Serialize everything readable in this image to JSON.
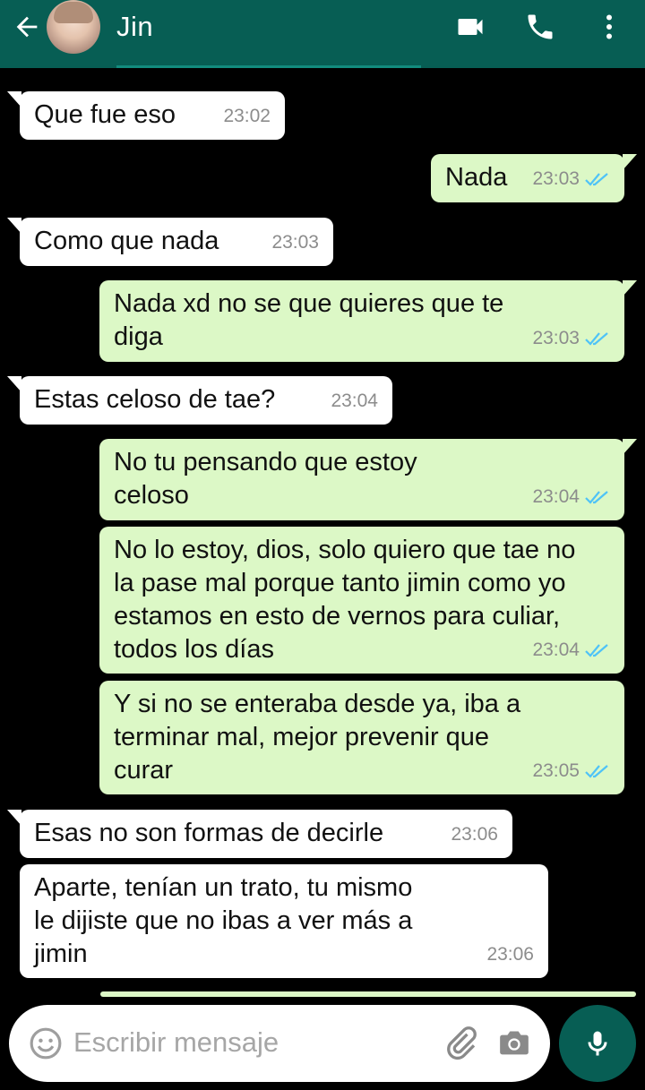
{
  "header": {
    "contact_name": "Jin",
    "icons": [
      "back-arrow-icon",
      "avatar",
      "video-call-icon",
      "phone-icon",
      "more-vert-icon"
    ],
    "colors": {
      "bar": "#075E54"
    }
  },
  "messages": [
    {
      "side": "in",
      "text": "Que fue eso",
      "time": "23:02"
    },
    {
      "side": "out",
      "text": "Nada",
      "time": "23:03",
      "status": "read"
    },
    {
      "side": "in",
      "text": "Como que nada",
      "time": "23:03"
    },
    {
      "side": "out",
      "text": "Nada xd no se que quieres que te\ndiga",
      "time": "23:03",
      "status": "read"
    },
    {
      "side": "in",
      "text": "Estas celoso de tae?",
      "time": "23:04"
    },
    {
      "side": "out",
      "text": "No tu pensando que estoy\nceloso",
      "time": "23:04",
      "status": "read"
    },
    {
      "side": "out",
      "text": "No lo estoy, dios, solo quiero que tae no\nla pase mal porque tanto jimin como yo\nestamos en esto de vernos para culiar,\ntodos los días",
      "time": "23:04",
      "status": "read"
    },
    {
      "side": "out",
      "text": "Y si no se enteraba desde ya, iba a\nterminar mal, mejor prevenir que\ncurar",
      "time": "23:05",
      "status": "read"
    },
    {
      "side": "in",
      "text": "Esas no son formas de decirle",
      "time": "23:06"
    },
    {
      "side": "in",
      "text": "Aparte, tenían un trato, tu mismo\nle dijiste que no ibas a ver más a\njimin",
      "time": "23:06"
    }
  ],
  "composer": {
    "placeholder": "Escribir mensaje",
    "icons": [
      "emoji-icon",
      "attach-icon",
      "camera-icon",
      "mic-icon"
    ]
  },
  "colors": {
    "incoming_bubble": "#FFFFFF",
    "outgoing_bubble": "#DCF8C6",
    "read_ticks": "#4FC3F7",
    "timestamp": "#8C8C8C"
  }
}
